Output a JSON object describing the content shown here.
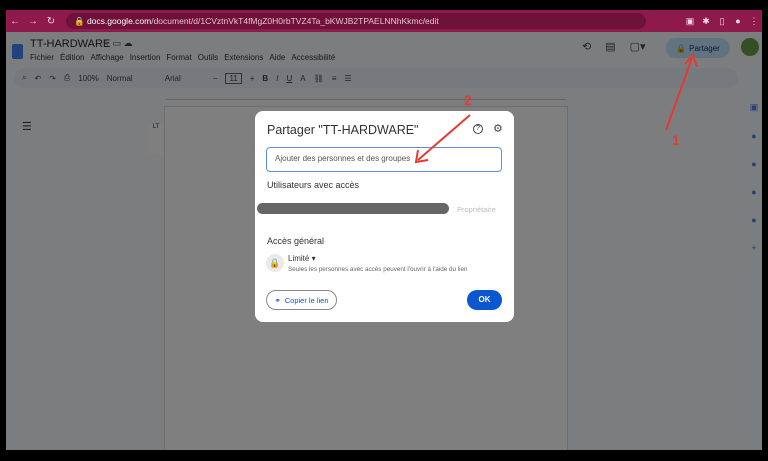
{
  "browser": {
    "url_domain": "docs.google.com",
    "url_path": "/document/d/1CVztnVkT4fMgZ0H0rbTVZ4Ta_bKWJB2TPAELNNhKkmc/edit"
  },
  "doc": {
    "title": "TT-HARDWARE",
    "menu": [
      "Fichier",
      "Édition",
      "Affichage",
      "Insertion",
      "Format",
      "Outils",
      "Extensions",
      "Aide",
      "Accessibilité"
    ],
    "share_label": "Partager"
  },
  "toolbar": {
    "zoom": "100%",
    "style": "Normal",
    "font": "Arial",
    "font_size": "11"
  },
  "dialog": {
    "title": "Partager \"TT-HARDWARE\"",
    "add_placeholder": "Ajouter des personnes et des groupes",
    "users_header": "Utilisateurs avec accès",
    "owner_role": "Propriétaire",
    "general_header": "Accès général",
    "access_level": "Limité",
    "access_desc": "Seules les personnes avec accès peuvent l'ouvrir à l'aide du lien",
    "copy_link": "Copier le lien",
    "ok": "OK"
  },
  "annotations": {
    "one": "1",
    "two": "2"
  },
  "colors": {
    "chrome": "#8e1a4b",
    "primary": "#0b57d0",
    "arrow": "#e53935"
  }
}
